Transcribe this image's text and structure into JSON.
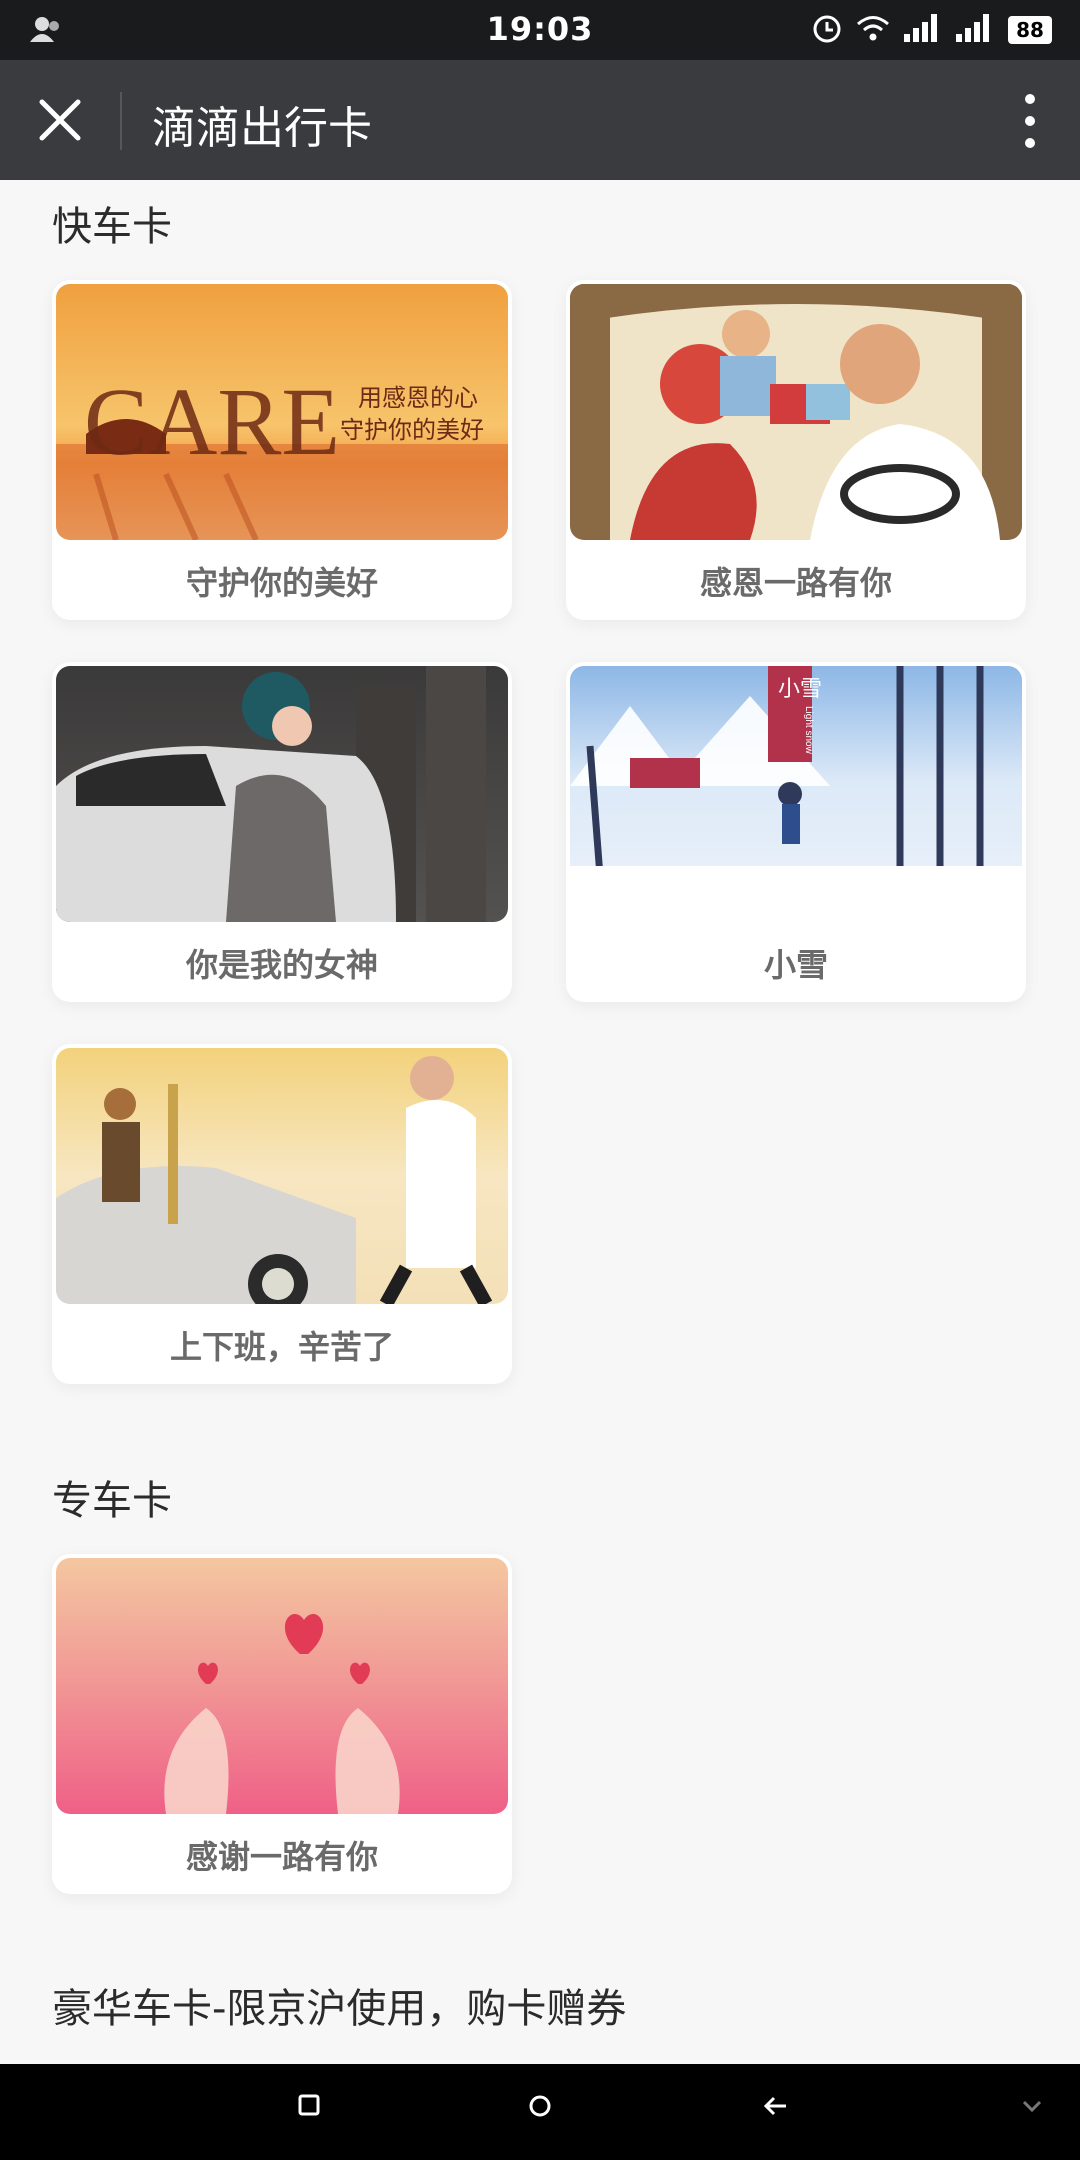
{
  "status_bar": {
    "time": "19:03",
    "battery": "88",
    "icons": [
      "user-icon",
      "alarm-icon",
      "wifi-icon",
      "signal-icon",
      "signal-icon",
      "battery-icon"
    ]
  },
  "header": {
    "title": "滴滴出行卡",
    "icons": [
      "close-icon",
      "more-vert-icon"
    ]
  },
  "sections": {
    "express": {
      "title": "快车卡",
      "cards": [
        {
          "label": "守护你的美好",
          "image_text_1": "用感恩的心",
          "image_text_2": "守护你的美好",
          "image_word": "CARE"
        },
        {
          "label": "感恩一路有你"
        },
        {
          "label": "你是我的女神"
        },
        {
          "label": "小雪",
          "image_sign": "小雪",
          "image_sign_en": "Light snow"
        },
        {
          "label": "上下班，辛苦了"
        }
      ]
    },
    "premier": {
      "title": "专车卡",
      "cards": [
        {
          "label": "感谢一路有你"
        }
      ]
    },
    "luxury": {
      "title": "豪华车卡-限京沪使用，购卡赠券"
    }
  },
  "nav_bar": {
    "icons": [
      "recent-apps-icon",
      "home-icon",
      "back-icon",
      "collapse-icon"
    ]
  }
}
